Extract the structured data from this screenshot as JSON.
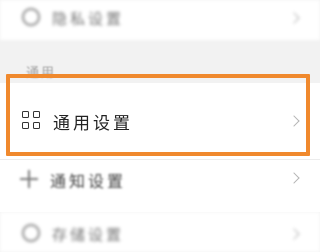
{
  "rows": {
    "privacy": {
      "label": "隐私设置"
    },
    "general": {
      "label": "通用设置"
    },
    "notify": {
      "label": "通知设置"
    },
    "storage": {
      "label": "存储设置"
    }
  },
  "section": {
    "header": "通用"
  },
  "colors": {
    "highlight": "#f0892d",
    "background": "#f2f2f2",
    "row": "#ffffff"
  },
  "icons": {
    "privacy": "circle-icon",
    "general": "grid-icon",
    "notify": "plus-icon",
    "storage": "circle-icon",
    "chevron": "chevron-right-icon"
  }
}
